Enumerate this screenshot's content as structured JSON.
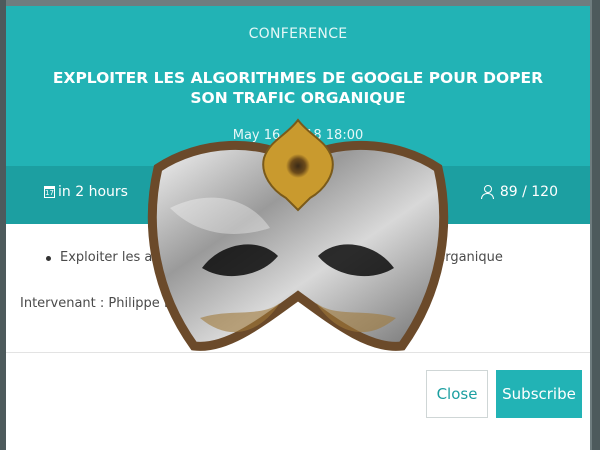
{
  "event": {
    "type": "CONFERENCE",
    "title": "EXPLOITER LES ALGORITHMES DE GOOGLE POUR DOPER SON TRAFIC ORGANIQUE",
    "date": "May 16, 2018 18:00",
    "duration": "in 2 hours",
    "attendance": "89 / 120",
    "topics": [
      "Exploiter les algorithmes de Google pour doper son trafic organique"
    ],
    "speaker": "Intervenant : Philippe El Khoury"
  },
  "actions": {
    "close_label": "Close",
    "subscribe_label": "Subscribe"
  },
  "icons": {
    "duration": "calendar-icon",
    "attendance": "user-icon"
  },
  "colors": {
    "header": "#22b3b5",
    "info_bar": "#1c9fa1",
    "accent": "#22b3b5"
  }
}
